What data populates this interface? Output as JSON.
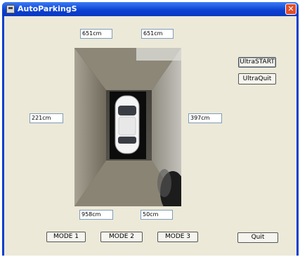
{
  "window": {
    "title": "AutoParkingS",
    "close_label": "✕"
  },
  "distances": {
    "front_left": "651cm",
    "front_right": "651cm",
    "left": "221cm",
    "right": "397cm",
    "rear_left": "958cm",
    "rear_right": "50cm"
  },
  "buttons": {
    "ultra_start": "UltraSTART",
    "ultra_quit": "UltraQuit",
    "mode1": "MODE 1",
    "mode2": "MODE 2",
    "mode3": "MODE 3",
    "quit": "Quit"
  },
  "camera": {
    "description_icon": "car-top-view"
  }
}
